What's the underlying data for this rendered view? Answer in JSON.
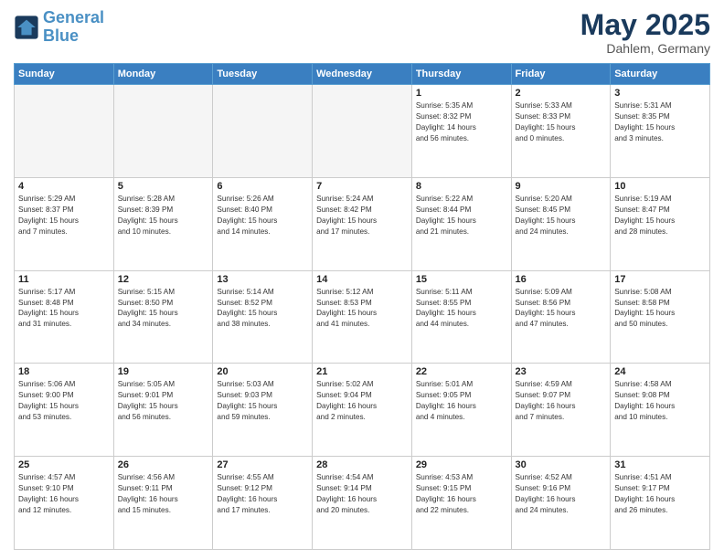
{
  "header": {
    "logo_general": "General",
    "logo_blue": "Blue",
    "month_title": "May 2025",
    "location": "Dahlem, Germany"
  },
  "days_of_week": [
    "Sunday",
    "Monday",
    "Tuesday",
    "Wednesday",
    "Thursday",
    "Friday",
    "Saturday"
  ],
  "weeks": [
    [
      {
        "num": "",
        "info": ""
      },
      {
        "num": "",
        "info": ""
      },
      {
        "num": "",
        "info": ""
      },
      {
        "num": "",
        "info": ""
      },
      {
        "num": "1",
        "info": "Sunrise: 5:35 AM\nSunset: 8:32 PM\nDaylight: 14 hours\nand 56 minutes."
      },
      {
        "num": "2",
        "info": "Sunrise: 5:33 AM\nSunset: 8:33 PM\nDaylight: 15 hours\nand 0 minutes."
      },
      {
        "num": "3",
        "info": "Sunrise: 5:31 AM\nSunset: 8:35 PM\nDaylight: 15 hours\nand 3 minutes."
      }
    ],
    [
      {
        "num": "4",
        "info": "Sunrise: 5:29 AM\nSunset: 8:37 PM\nDaylight: 15 hours\nand 7 minutes."
      },
      {
        "num": "5",
        "info": "Sunrise: 5:28 AM\nSunset: 8:39 PM\nDaylight: 15 hours\nand 10 minutes."
      },
      {
        "num": "6",
        "info": "Sunrise: 5:26 AM\nSunset: 8:40 PM\nDaylight: 15 hours\nand 14 minutes."
      },
      {
        "num": "7",
        "info": "Sunrise: 5:24 AM\nSunset: 8:42 PM\nDaylight: 15 hours\nand 17 minutes."
      },
      {
        "num": "8",
        "info": "Sunrise: 5:22 AM\nSunset: 8:44 PM\nDaylight: 15 hours\nand 21 minutes."
      },
      {
        "num": "9",
        "info": "Sunrise: 5:20 AM\nSunset: 8:45 PM\nDaylight: 15 hours\nand 24 minutes."
      },
      {
        "num": "10",
        "info": "Sunrise: 5:19 AM\nSunset: 8:47 PM\nDaylight: 15 hours\nand 28 minutes."
      }
    ],
    [
      {
        "num": "11",
        "info": "Sunrise: 5:17 AM\nSunset: 8:48 PM\nDaylight: 15 hours\nand 31 minutes."
      },
      {
        "num": "12",
        "info": "Sunrise: 5:15 AM\nSunset: 8:50 PM\nDaylight: 15 hours\nand 34 minutes."
      },
      {
        "num": "13",
        "info": "Sunrise: 5:14 AM\nSunset: 8:52 PM\nDaylight: 15 hours\nand 38 minutes."
      },
      {
        "num": "14",
        "info": "Sunrise: 5:12 AM\nSunset: 8:53 PM\nDaylight: 15 hours\nand 41 minutes."
      },
      {
        "num": "15",
        "info": "Sunrise: 5:11 AM\nSunset: 8:55 PM\nDaylight: 15 hours\nand 44 minutes."
      },
      {
        "num": "16",
        "info": "Sunrise: 5:09 AM\nSunset: 8:56 PM\nDaylight: 15 hours\nand 47 minutes."
      },
      {
        "num": "17",
        "info": "Sunrise: 5:08 AM\nSunset: 8:58 PM\nDaylight: 15 hours\nand 50 minutes."
      }
    ],
    [
      {
        "num": "18",
        "info": "Sunrise: 5:06 AM\nSunset: 9:00 PM\nDaylight: 15 hours\nand 53 minutes."
      },
      {
        "num": "19",
        "info": "Sunrise: 5:05 AM\nSunset: 9:01 PM\nDaylight: 15 hours\nand 56 minutes."
      },
      {
        "num": "20",
        "info": "Sunrise: 5:03 AM\nSunset: 9:03 PM\nDaylight: 15 hours\nand 59 minutes."
      },
      {
        "num": "21",
        "info": "Sunrise: 5:02 AM\nSunset: 9:04 PM\nDaylight: 16 hours\nand 2 minutes."
      },
      {
        "num": "22",
        "info": "Sunrise: 5:01 AM\nSunset: 9:05 PM\nDaylight: 16 hours\nand 4 minutes."
      },
      {
        "num": "23",
        "info": "Sunrise: 4:59 AM\nSunset: 9:07 PM\nDaylight: 16 hours\nand 7 minutes."
      },
      {
        "num": "24",
        "info": "Sunrise: 4:58 AM\nSunset: 9:08 PM\nDaylight: 16 hours\nand 10 minutes."
      }
    ],
    [
      {
        "num": "25",
        "info": "Sunrise: 4:57 AM\nSunset: 9:10 PM\nDaylight: 16 hours\nand 12 minutes."
      },
      {
        "num": "26",
        "info": "Sunrise: 4:56 AM\nSunset: 9:11 PM\nDaylight: 16 hours\nand 15 minutes."
      },
      {
        "num": "27",
        "info": "Sunrise: 4:55 AM\nSunset: 9:12 PM\nDaylight: 16 hours\nand 17 minutes."
      },
      {
        "num": "28",
        "info": "Sunrise: 4:54 AM\nSunset: 9:14 PM\nDaylight: 16 hours\nand 20 minutes."
      },
      {
        "num": "29",
        "info": "Sunrise: 4:53 AM\nSunset: 9:15 PM\nDaylight: 16 hours\nand 22 minutes."
      },
      {
        "num": "30",
        "info": "Sunrise: 4:52 AM\nSunset: 9:16 PM\nDaylight: 16 hours\nand 24 minutes."
      },
      {
        "num": "31",
        "info": "Sunrise: 4:51 AM\nSunset: 9:17 PM\nDaylight: 16 hours\nand 26 minutes."
      }
    ]
  ]
}
